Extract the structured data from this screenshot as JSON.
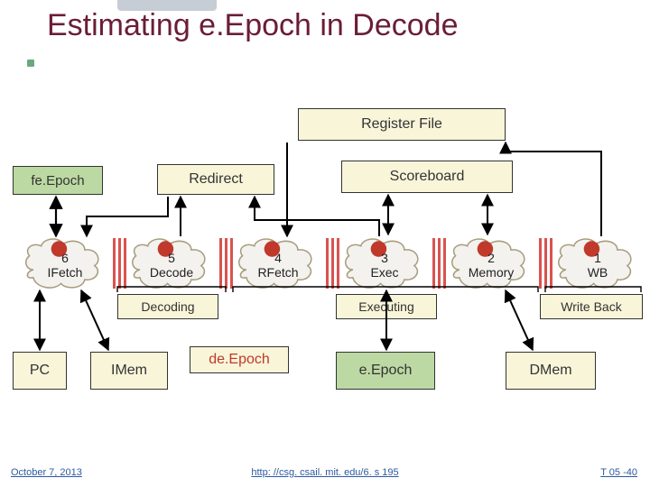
{
  "title": "Estimating e.Epoch in Decode",
  "boxes": {
    "register_file": "Register File",
    "redirect": "Redirect",
    "scoreboard": "Scoreboard",
    "fe_epoch": "fe.Epoch",
    "de_epoch": "de.Epoch",
    "e_epoch": "e.Epoch",
    "pc": "PC",
    "imem": "IMem",
    "dmem": "DMem"
  },
  "stages": [
    {
      "num": "6",
      "name": "IFetch"
    },
    {
      "num": "5",
      "name": "Decode"
    },
    {
      "num": "4",
      "name": "RFetch"
    },
    {
      "num": "3",
      "name": "Exec"
    },
    {
      "num": "2",
      "name": "Memory"
    },
    {
      "num": "1",
      "name": "WB"
    }
  ],
  "phase_labels": {
    "decoding": "Decoding",
    "executing": "Executing",
    "writeback": "Write Back"
  },
  "footer": {
    "date": "October 7, 2013",
    "url": "http: //csg. csail. mit. edu/6. s 195",
    "page": "T 05 -40"
  }
}
